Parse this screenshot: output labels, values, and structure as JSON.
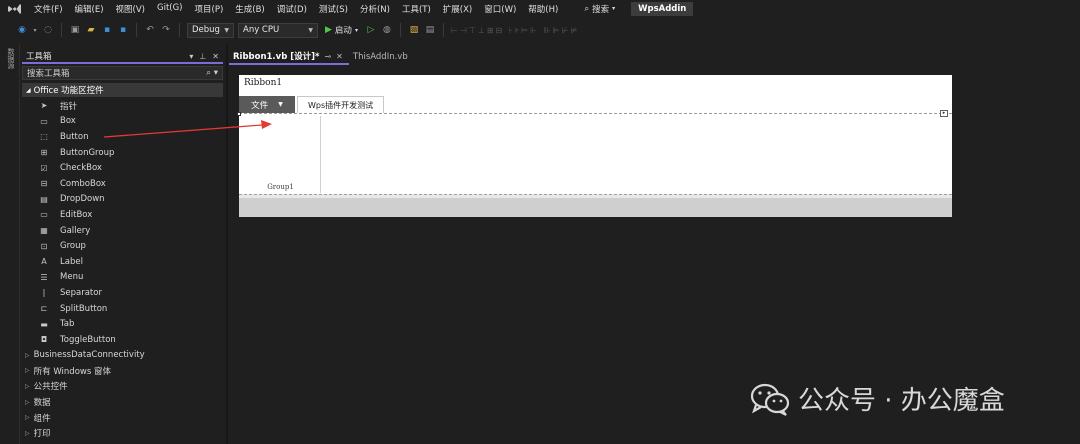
{
  "menu": {
    "items": [
      "文件(F)",
      "编辑(E)",
      "视图(V)",
      "Git(G)",
      "项目(P)",
      "生成(B)",
      "调试(D)",
      "测试(S)",
      "分析(N)",
      "工具(T)",
      "扩展(X)",
      "窗口(W)",
      "帮助(H)"
    ],
    "search_label": "搜索",
    "project_name": "WpsAddin"
  },
  "toolbar": {
    "config": "Debug",
    "platform": "Any CPU",
    "start_label": "启动"
  },
  "left_strip": {
    "label": "数据源"
  },
  "toolbox": {
    "title": "工具箱",
    "search_placeholder": "搜索工具箱",
    "group_label": "Office 功能区控件",
    "items": [
      {
        "label": "指针",
        "icon": "pointer-icon",
        "glyph": "➤"
      },
      {
        "label": "Box",
        "icon": "box-icon",
        "glyph": "▭"
      },
      {
        "label": "Button",
        "icon": "button-icon",
        "glyph": "⬚"
      },
      {
        "label": "ButtonGroup",
        "icon": "buttongroup-icon",
        "glyph": "⊞"
      },
      {
        "label": "CheckBox",
        "icon": "checkbox-icon",
        "glyph": "☑"
      },
      {
        "label": "ComboBox",
        "icon": "combobox-icon",
        "glyph": "⊟"
      },
      {
        "label": "DropDown",
        "icon": "dropdown-icon",
        "glyph": "▤"
      },
      {
        "label": "EditBox",
        "icon": "editbox-icon",
        "glyph": "▭"
      },
      {
        "label": "Gallery",
        "icon": "gallery-icon",
        "glyph": "▦"
      },
      {
        "label": "Group",
        "icon": "group-icon",
        "glyph": "⊡"
      },
      {
        "label": "Label",
        "icon": "label-icon",
        "glyph": "A"
      },
      {
        "label": "Menu",
        "icon": "menu-icon",
        "glyph": "☰"
      },
      {
        "label": "Separator",
        "icon": "separator-icon",
        "glyph": "|"
      },
      {
        "label": "SplitButton",
        "icon": "splitbutton-icon",
        "glyph": "⊏"
      },
      {
        "label": "Tab",
        "icon": "tab-icon",
        "glyph": "▬"
      },
      {
        "label": "ToggleButton",
        "icon": "togglebutton-icon",
        "glyph": "◘"
      }
    ],
    "categories": [
      "BusinessDataConnectivity",
      "所有 Windows 窗体",
      "公共控件",
      "数据",
      "组件",
      "打印"
    ]
  },
  "tabs": {
    "active": "Ribbon1.vb [设计]*",
    "inactive": "ThisAddIn.vb"
  },
  "designer": {
    "ribbon_name": "Ribbon1",
    "file_tab": "文件",
    "custom_tab": "Wps插件开发测试",
    "group_label": "Group1"
  },
  "watermark": {
    "text": "公众号 · 办公魔盒"
  },
  "colors": {
    "accent": "#7d6bd8",
    "arrow": "#e53935",
    "play": "#4ec94e"
  }
}
